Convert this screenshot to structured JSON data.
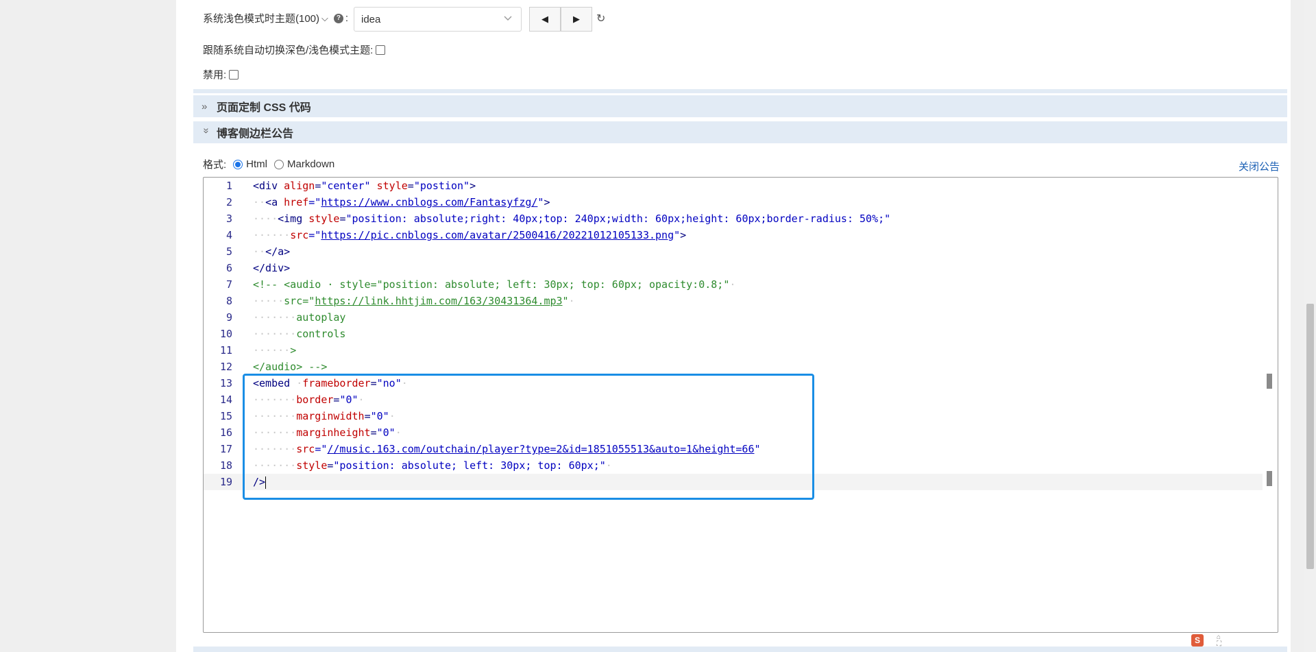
{
  "theme_setting": {
    "label": "系统浅色模式时主题(100)",
    "chevron": "⌵",
    "help_icon": "?",
    "colon": ":",
    "select_value": "idea",
    "prev_icon": "◀",
    "next_icon": "▶",
    "reset_icon": "↻"
  },
  "auto_switch": {
    "label": "跟随系统自动切换深色/浅色模式主题:"
  },
  "disable": {
    "label": "禁用:"
  },
  "sections": {
    "custom_css": {
      "icon": "»",
      "title": "页面定制 CSS 代码"
    },
    "sidebar_notice": {
      "icon": "»",
      "title": "博客侧边栏公告"
    }
  },
  "format": {
    "label": "格式:",
    "options": [
      "Html",
      "Markdown"
    ],
    "selected": "Html"
  },
  "close_notice": "关闭公告",
  "editor": {
    "line_numbers": [
      "1",
      "2",
      "3",
      "4",
      "5",
      "6",
      "7",
      "8",
      "9",
      "10",
      "11",
      "12",
      "13",
      "14",
      "15",
      "16",
      "17",
      "18",
      "19"
    ],
    "lines": {
      "l1": {
        "tag": "<div ",
        "a1": "align",
        "eq1": "=",
        "s1": "\"center\"",
        "sp": " ",
        "a2": "style",
        "eq2": "=",
        "s2": "\"postion\"",
        "end": ">"
      },
      "l2": {
        "ws": "··",
        "tag": "<a ",
        "a1": "href",
        "eq1": "=\"",
        "url": "https://www.cnblogs.com/Fantasyfzg/",
        "close": "\"",
        "end": ">"
      },
      "l3": {
        "ws": "····",
        "tag": "<img ",
        "a1": "style",
        "eq1": "=",
        "s1": "\"position: absolute;right: 40px;top: 240px;width: 60px;height: 60px;border-radius: 50%;\""
      },
      "l4": {
        "ws": "······",
        "a1": "src",
        "eq1": "=\"",
        "url": "https://pic.cnblogs.com/avatar/2500416/20221012105133.png",
        "close": "\"",
        "end": ">"
      },
      "l5": {
        "ws": "··",
        "tag": "</a>"
      },
      "l6": {
        "tag": "</div>"
      },
      "l7": {
        "com": "<!-- <audio · style=\"position: absolute; left: 30px; top: 60px; opacity:0.8;\"",
        "ws": "·"
      },
      "l8": {
        "ws": "·····",
        "com": "src=\"",
        "url": "https://link.hhtjim.com/163/30431364.mp3",
        "com2": "\"",
        "ws2": "·"
      },
      "l9": {
        "ws": "·······",
        "com": "autoplay"
      },
      "l10": {
        "ws": "·······",
        "com": "controls"
      },
      "l11": {
        "ws": "······",
        "com": ">"
      },
      "l12": {
        "com": "</audio> -->"
      },
      "l13": {
        "tag": "<embed ",
        "ws": "·",
        "a1": "frameborder",
        "eq1": "=",
        "s1": "\"no\"",
        "ws2": "·"
      },
      "l14": {
        "ws": "·······",
        "a1": "border",
        "eq1": "=",
        "s1": "\"0\"",
        "ws2": "·"
      },
      "l15": {
        "ws": "·······",
        "a1": "marginwidth",
        "eq1": "=",
        "s1": "\"0\"",
        "ws2": "·"
      },
      "l16": {
        "ws": "·······",
        "a1": "marginheight",
        "eq1": "=",
        "s1": "\"0\"",
        "ws2": "·"
      },
      "l17": {
        "ws": "·······",
        "a1": "src",
        "eq1": "=\"",
        "url": "//music.163.com/outchain/player?type=2&id=1851055513&auto=1&height=66",
        "close": "\""
      },
      "l18": {
        "ws": "·······",
        "a1": "style",
        "eq1": "=",
        "s1": "\"position: absolute; left: 30px; top: 60px;\"",
        "ws2": "·"
      },
      "l19": {
        "tag": "/>"
      }
    }
  },
  "corner": {
    "logo": "S",
    "icon_top": "⌂",
    "icon_bottom": "⛶"
  },
  "colors": {
    "section_bg": "#e2ebf5",
    "highlight": "#1a8ee5",
    "link": "#1a5fb4"
  }
}
